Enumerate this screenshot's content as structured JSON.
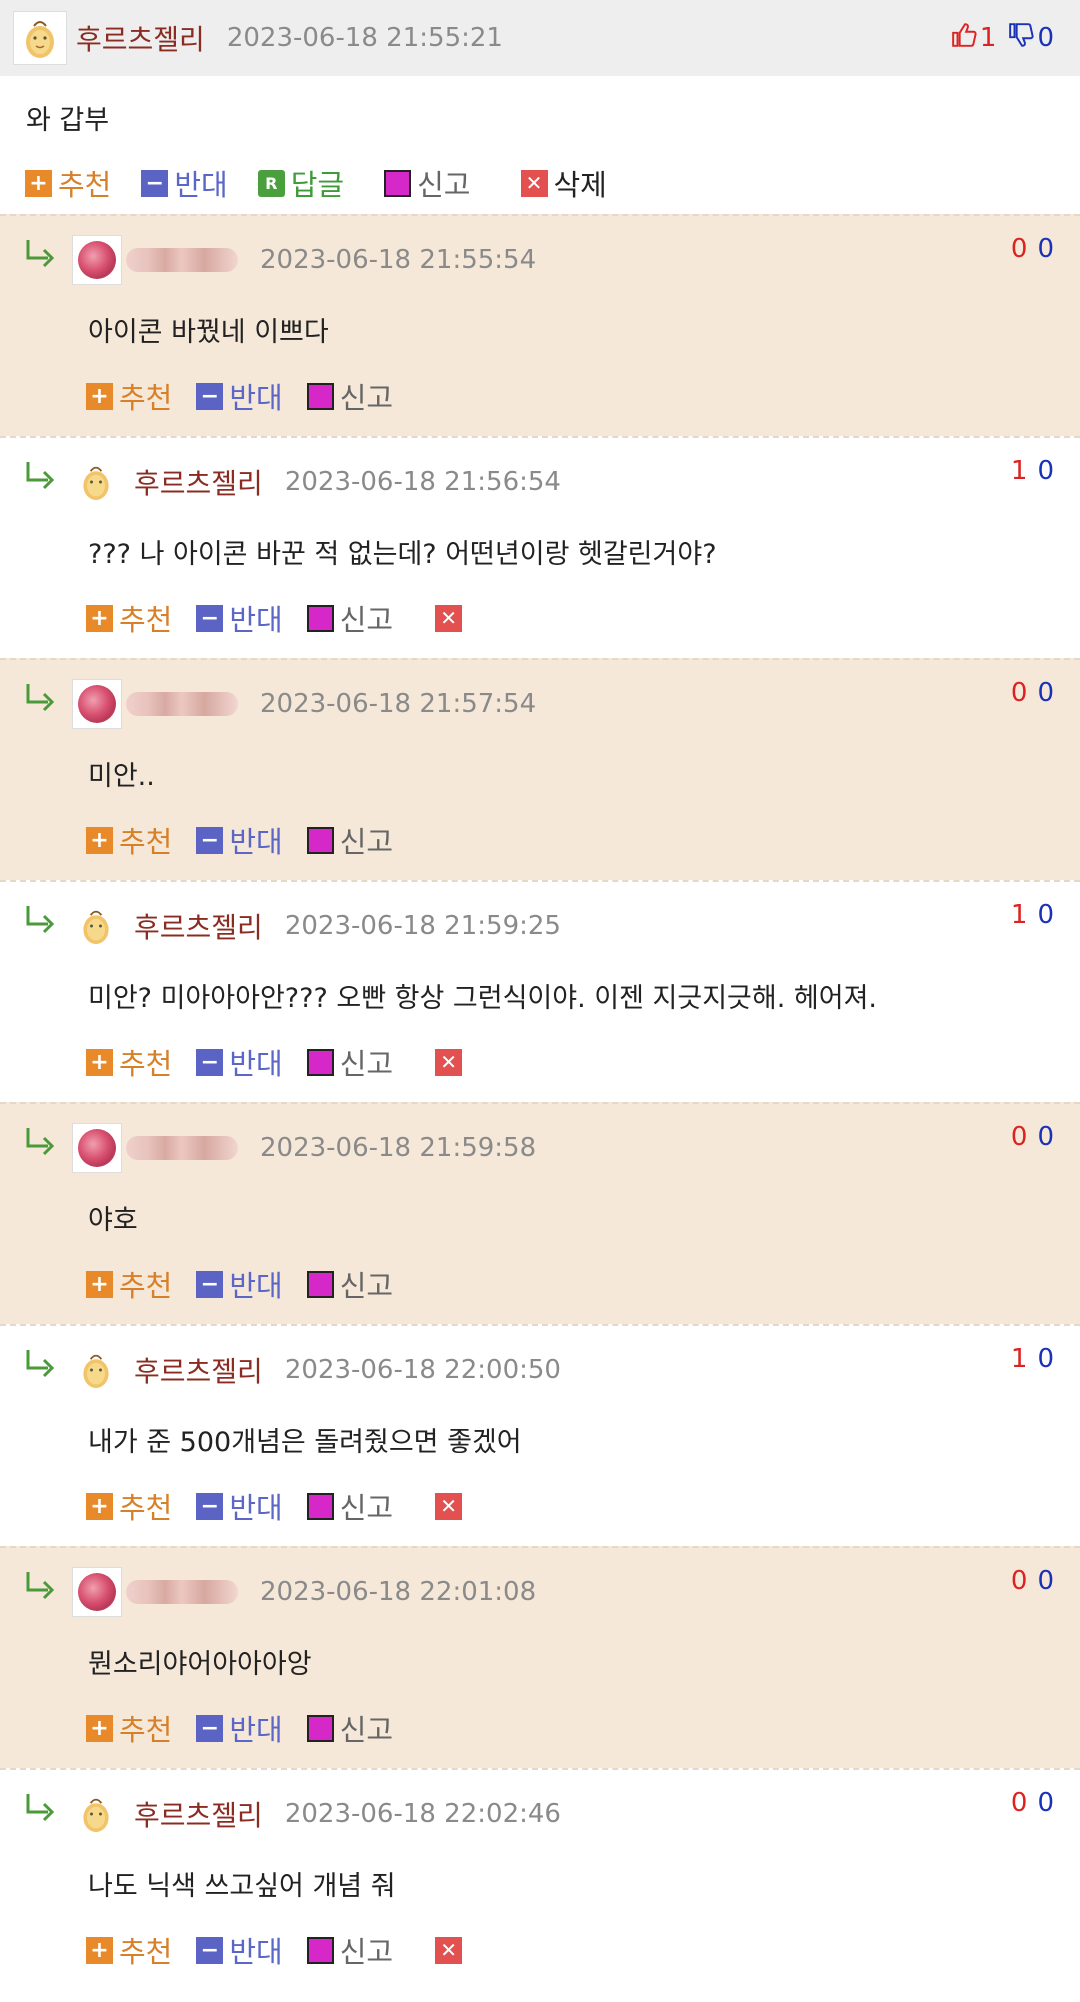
{
  "post": {
    "nickname": "후르츠젤리",
    "date": "2023-06-18 21:55:21",
    "up_count": "1",
    "down_count": "0",
    "text": "와 갑부",
    "actions": {
      "recommend": "추천",
      "oppose": "반대",
      "reply": "답글",
      "report": "신고",
      "delete": "삭제"
    }
  },
  "labels": {
    "recommend": "추천",
    "oppose": "반대",
    "report": "신고"
  },
  "comments": [
    {
      "nickname": "",
      "date": "2023-06-18 21:55:54",
      "up": "0",
      "down": "0",
      "text": "아이콘 바꿨네 이쁘다"
    },
    {
      "nickname": "후르츠젤리",
      "date": "2023-06-18 21:56:54",
      "up": "1",
      "down": "0",
      "text": "??? 나 아이콘 바꾼 적 없는데? 어떤년이랑 헷갈린거야?"
    },
    {
      "nickname": "",
      "date": "2023-06-18 21:57:54",
      "up": "0",
      "down": "0",
      "text": "미안.."
    },
    {
      "nickname": "후르츠젤리",
      "date": "2023-06-18 21:59:25",
      "up": "1",
      "down": "0",
      "text": "미안? 미아아아안??? 오빤 항상 그런식이야. 이젠 지긋지긋해. 헤어져."
    },
    {
      "nickname": "",
      "date": "2023-06-18 21:59:58",
      "up": "0",
      "down": "0",
      "text": "야호"
    },
    {
      "nickname": "후르츠젤리",
      "date": "2023-06-18 22:00:50",
      "up": "1",
      "down": "0",
      "text": "내가 준 500개념은 돌려줬으면 좋겠어"
    },
    {
      "nickname": "",
      "date": "2023-06-18 22:01:08",
      "up": "0",
      "down": "0",
      "text": "뭔소리야어아아아앙"
    },
    {
      "nickname": "후르츠젤리",
      "date": "2023-06-18 22:02:46",
      "up": "0",
      "down": "0",
      "text": "나도 닉색 쓰고싶어 개념 줘"
    }
  ],
  "colors": {
    "nickname": "#8b2c22",
    "tinted_row": "#f6e8d8",
    "header_bg": "#eeeeee",
    "up": "#dd2222",
    "down": "#1a32b8"
  }
}
